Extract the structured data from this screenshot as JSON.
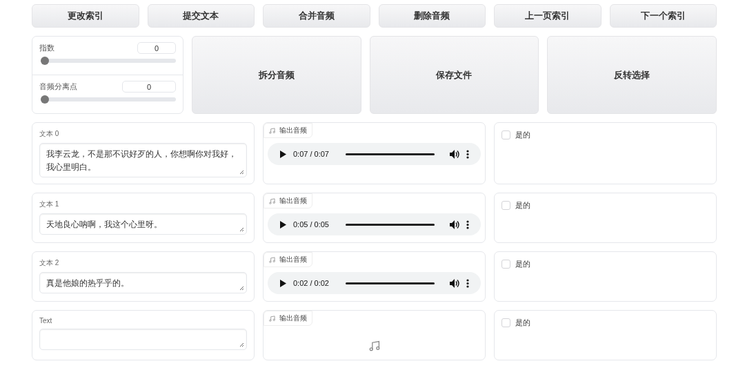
{
  "top_buttons": [
    "更改索引",
    "提交文本",
    "合并音频",
    "删除音频",
    "上一页索引",
    "下一个索引"
  ],
  "sliders": [
    {
      "label": "指数",
      "value": "0",
      "level": 0
    },
    {
      "label": "音频分离点",
      "value": "0",
      "level": 0
    }
  ],
  "big_buttons": [
    "拆分音频",
    "保存文件",
    "反转选择"
  ],
  "rows": [
    {
      "text_label": "文本 0",
      "text": "我李云龙，不是那不识好歹的人，你想啊你对我好，我心里明白。",
      "audio_label": "输出音频",
      "audio": {
        "kind": "player",
        "time": "0:07 / 0:07",
        "level": 1
      },
      "check_label": "是的",
      "checked": false
    },
    {
      "text_label": "文本 1",
      "text": "天地良心呐啊，我这个心里呀。",
      "audio_label": "输出音频",
      "audio": {
        "kind": "player",
        "time": "0:05 / 0:05",
        "level": 1
      },
      "check_label": "是的",
      "checked": false
    },
    {
      "text_label": "文本 2",
      "text": "真是他娘的热乎乎的。",
      "audio_label": "输出音频",
      "audio": {
        "kind": "player",
        "time": "0:02 / 0:02",
        "level": 1
      },
      "check_label": "是的",
      "checked": false
    },
    {
      "text_label": "Text",
      "text": "",
      "audio_label": "输出音频",
      "audio": {
        "kind": "empty"
      },
      "check_label": "是的",
      "checked": false
    }
  ]
}
